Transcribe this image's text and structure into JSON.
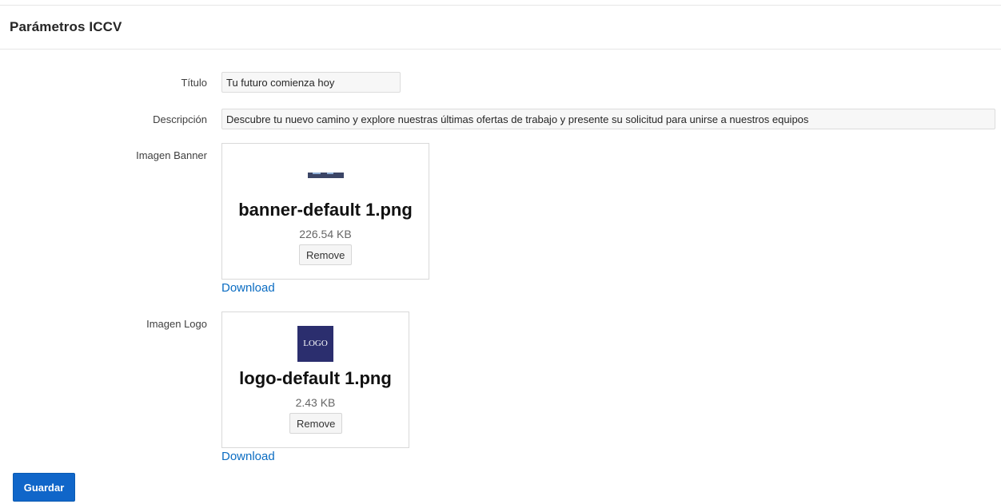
{
  "header": {
    "title": "Parámetros ICCV"
  },
  "form": {
    "titulo": {
      "label": "Título",
      "value": "Tu futuro comienza hoy"
    },
    "descripcion": {
      "label": "Descripción",
      "value": "Descubre tu nuevo camino y explore nuestras últimas ofertas de trabajo y presente su solicitud para unirse a nuestros equipos"
    },
    "imagen_banner": {
      "label": "Imagen Banner",
      "file_name": "banner-default 1.png",
      "file_size": "226.54 KB",
      "remove_label": "Remove",
      "download_label": "Download"
    },
    "imagen_logo": {
      "label": "Imagen Logo",
      "file_name": "logo-default 1.png",
      "file_size": "2.43 KB",
      "thumb_text": "LOGO",
      "remove_label": "Remove",
      "download_label": "Download"
    }
  },
  "actions": {
    "save_label": "Guardar"
  },
  "colors": {
    "accent": "#1066c9",
    "link": "#0a6cc2",
    "logo_bg": "#2b2e6e"
  }
}
